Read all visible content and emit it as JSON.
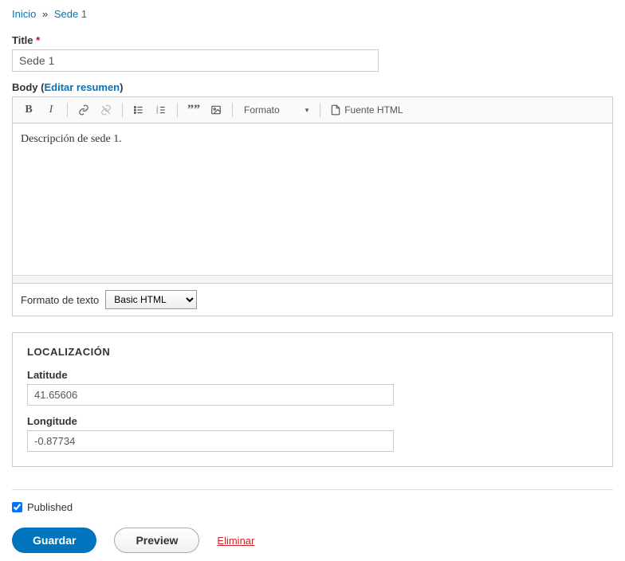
{
  "breadcrumb": {
    "home": "Inicio",
    "sep": "»",
    "current": "Sede 1"
  },
  "title": {
    "label": "Title",
    "value": "Sede 1"
  },
  "body": {
    "label": "Body",
    "edit_summary": "Editar resumen",
    "content": "Descripción de sede 1.",
    "toolbar": {
      "format_label": "Formato",
      "source_label": "Fuente HTML"
    },
    "text_format_label": "Formato de texto",
    "text_format_value": "Basic HTML"
  },
  "location": {
    "legend": "LOCALIZACIÓN",
    "latitude_label": "Latitude",
    "latitude_value": "41.65606",
    "longitude_label": "Longitude",
    "longitude_value": "-0.87734"
  },
  "published_label": "Published",
  "actions": {
    "save": "Guardar",
    "preview": "Preview",
    "delete": "Eliminar"
  }
}
